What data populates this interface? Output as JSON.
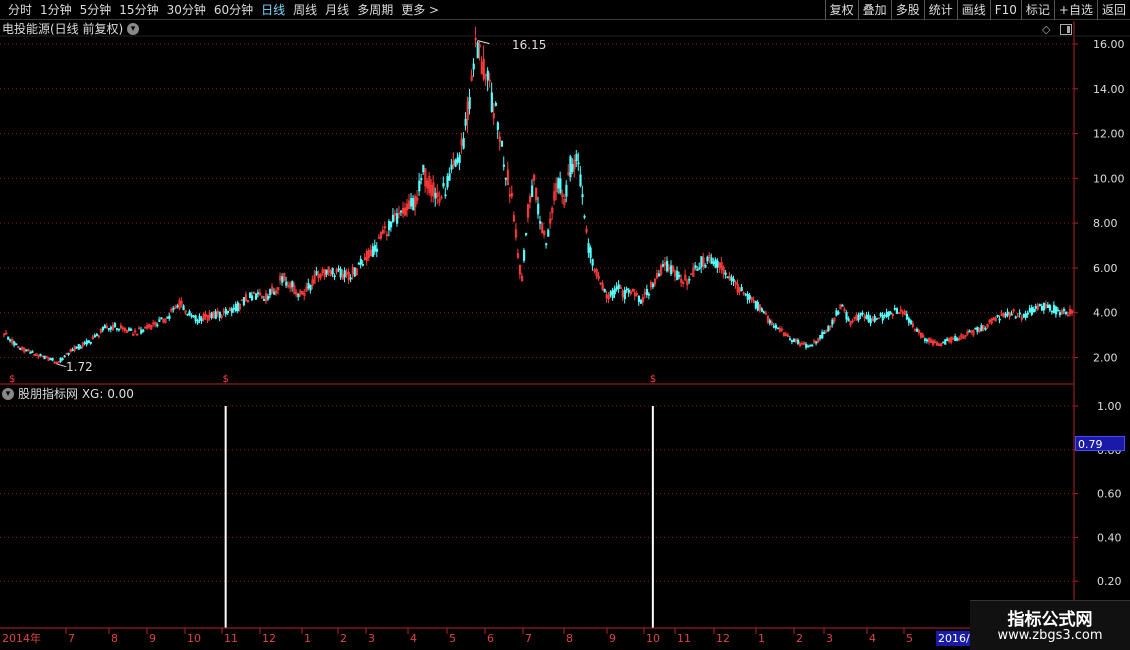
{
  "toolbar": {
    "periods": [
      "分时",
      "1分钟",
      "5分钟",
      "15分钟",
      "30分钟",
      "60分钟",
      "日线",
      "周线",
      "月线",
      "多周期",
      "更多 >"
    ],
    "active_period": "日线",
    "right_buttons": [
      "复权",
      "叠加",
      "多股",
      "统计",
      "画线",
      "F10",
      "标记",
      "+自选",
      "返回"
    ]
  },
  "stock": {
    "title": "电投能源(日线 前复权)",
    "high_label": "16.15",
    "low_label": "1.72"
  },
  "indicator": {
    "title": "股朋指标网 XG: 0.00",
    "cursor_value": "0.79"
  },
  "watermark": {
    "name": "指标公式网",
    "url": "www.zbgs3.com"
  },
  "colors": {
    "up": "#ff3a3a",
    "down": "#54ffff",
    "grid": "#8b1a1a",
    "axis": "#b22222"
  },
  "chart_data": [
    {
      "type": "candlestick",
      "ylim": [
        1.2,
        17.0
      ],
      "y_ticks": [
        "16.00",
        "14.00",
        "12.00",
        "10.00",
        "8.00",
        "6.00",
        "4.00",
        "2.00"
      ],
      "x_ticks": [
        "2014年",
        "7",
        "8",
        "9",
        "10",
        "11",
        "12",
        "1",
        "2",
        "3",
        "4",
        "5",
        "6",
        "7",
        "8",
        "9",
        "10",
        "11",
        "12",
        "1",
        "2",
        "3",
        "4",
        "5",
        "2016/0"
      ],
      "high": 16.15,
      "low": 1.72,
      "close_path": [
        [
          0,
          3.1
        ],
        [
          4,
          2.7
        ],
        [
          8,
          2.4
        ],
        [
          12,
          2.3
        ],
        [
          16,
          2.1
        ],
        [
          20,
          2.0
        ],
        [
          24,
          1.9
        ],
        [
          26,
          1.72
        ],
        [
          30,
          2.1
        ],
        [
          35,
          2.4
        ],
        [
          40,
          2.6
        ],
        [
          45,
          2.9
        ],
        [
          50,
          3.3
        ],
        [
          55,
          3.4
        ],
        [
          60,
          3.2
        ],
        [
          65,
          3.1
        ],
        [
          70,
          3.3
        ],
        [
          75,
          3.5
        ],
        [
          80,
          3.7
        ],
        [
          85,
          4.2
        ],
        [
          88,
          4.4
        ],
        [
          92,
          3.9
        ],
        [
          96,
          3.7
        ],
        [
          100,
          3.8
        ],
        [
          105,
          3.9
        ],
        [
          110,
          4.0
        ],
        [
          115,
          4.2
        ],
        [
          120,
          4.6
        ],
        [
          125,
          4.8
        ],
        [
          130,
          4.7
        ],
        [
          135,
          5.1
        ],
        [
          138,
          5.6
        ],
        [
          142,
          5.3
        ],
        [
          146,
          4.8
        ],
        [
          150,
          5.0
        ],
        [
          155,
          5.6
        ],
        [
          160,
          5.9
        ],
        [
          165,
          5.8
        ],
        [
          170,
          5.6
        ],
        [
          175,
          5.9
        ],
        [
          180,
          6.5
        ],
        [
          185,
          7.0
        ],
        [
          190,
          7.8
        ],
        [
          195,
          8.2
        ],
        [
          200,
          8.5
        ],
        [
          205,
          9.2
        ],
        [
          208,
          10.2
        ],
        [
          212,
          9.6
        ],
        [
          216,
          9.0
        ],
        [
          220,
          9.8
        ],
        [
          224,
          10.5
        ],
        [
          228,
          11.8
        ],
        [
          231,
          13.5
        ],
        [
          233,
          15.5
        ],
        [
          235,
          16.0
        ],
        [
          237,
          15.0
        ],
        [
          240,
          14.2
        ],
        [
          243,
          13.2
        ],
        [
          246,
          12.0
        ],
        [
          249,
          10.3
        ],
        [
          252,
          9.2
        ],
        [
          255,
          6.5
        ],
        [
          257,
          5.5
        ],
        [
          260,
          8.5
        ],
        [
          263,
          10.0
        ],
        [
          266,
          8.0
        ],
        [
          269,
          7.2
        ],
        [
          272,
          8.8
        ],
        [
          275,
          10.0
        ],
        [
          278,
          9.2
        ],
        [
          281,
          10.5
        ],
        [
          284,
          11.0
        ],
        [
          287,
          9.2
        ],
        [
          290,
          7.0
        ],
        [
          293,
          6.0
        ],
        [
          296,
          5.3
        ],
        [
          300,
          4.6
        ],
        [
          304,
          5.2
        ],
        [
          308,
          4.8
        ],
        [
          312,
          5.1
        ],
        [
          316,
          4.4
        ],
        [
          320,
          5.0
        ],
        [
          325,
          5.8
        ],
        [
          330,
          6.1
        ],
        [
          335,
          5.6
        ],
        [
          340,
          5.4
        ],
        [
          345,
          6.2
        ],
        [
          350,
          6.4
        ],
        [
          355,
          6.1
        ],
        [
          360,
          5.6
        ],
        [
          365,
          5.0
        ],
        [
          370,
          4.6
        ],
        [
          375,
          4.2
        ],
        [
          380,
          3.6
        ],
        [
          385,
          3.2
        ],
        [
          390,
          2.9
        ],
        [
          395,
          2.6
        ],
        [
          400,
          2.5
        ],
        [
          405,
          2.9
        ],
        [
          410,
          3.4
        ],
        [
          415,
          4.3
        ],
        [
          420,
          3.6
        ],
        [
          425,
          3.9
        ],
        [
          430,
          3.7
        ],
        [
          435,
          3.8
        ],
        [
          440,
          4.0
        ],
        [
          445,
          4.1
        ],
        [
          450,
          3.6
        ],
        [
          455,
          3.0
        ],
        [
          460,
          2.7
        ],
        [
          465,
          2.6
        ],
        [
          470,
          2.8
        ],
        [
          475,
          2.9
        ],
        [
          480,
          3.1
        ],
        [
          485,
          3.3
        ],
        [
          490,
          3.6
        ],
        [
          495,
          3.9
        ],
        [
          500,
          4.0
        ],
        [
          505,
          3.8
        ],
        [
          510,
          4.1
        ],
        [
          515,
          4.3
        ],
        [
          520,
          4.2
        ],
        [
          525,
          4.0
        ],
        [
          530,
          4.1
        ]
      ]
    },
    {
      "type": "bar",
      "name": "XG",
      "ylim": [
        0,
        1.1
      ],
      "y_ticks": [
        "1.00",
        "0.80",
        "0.60",
        "0.40",
        "0.20"
      ],
      "signals": [
        {
          "x": 110,
          "value": 1.0
        },
        {
          "x": 322,
          "value": 1.0
        }
      ]
    }
  ]
}
